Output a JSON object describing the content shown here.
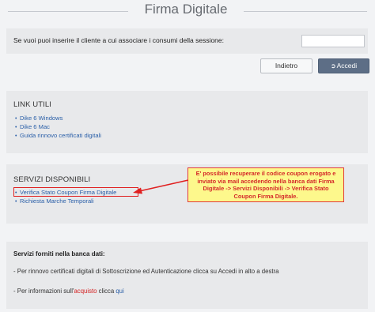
{
  "page": {
    "title": "Firma Digitale"
  },
  "client": {
    "prompt": "Se vuoi puoi inserire il cliente a cui associare i consumi della sessione:",
    "input_value": "",
    "input_placeholder": ""
  },
  "buttons": {
    "back_label": "Indietro",
    "login_label": "Accedi",
    "login_icon": "sign-in-icon"
  },
  "links_panel": {
    "heading": "LINK UTILI",
    "items": [
      {
        "label": "Dike 6 Windows"
      },
      {
        "label": "Dike 6 Mac"
      },
      {
        "label": "Guida rinnovo certificati digitali"
      }
    ]
  },
  "services_panel": {
    "heading": "SERVIZI DISPONIBILI",
    "items": [
      {
        "label": "Verifica Stato Coupon Firma Digitale"
      },
      {
        "label": "Richiesta Marche Temporali"
      }
    ]
  },
  "callout": {
    "text": "E' possibile recuperare il codice coupon erogato e inviato via mail accedendo nella banca dati Firma Digitale -> Servizi Disponibili -> Verifica Stato Coupon Firma Digitale."
  },
  "info_panel": {
    "heading": "Servizi forniti nella banca dati:",
    "line1": "- Per rinnovo certificati digitali di Sottoscrizione ed Autenticazione clicca su Accedi in alto a destra",
    "line2_prefix": "- Per informazioni sull'",
    "line2_link1": "acquisto",
    "line2_middle": " clicca ",
    "line2_link2": "qui"
  },
  "colors": {
    "background": "#f2f3f5",
    "panel": "#e8e9eb",
    "link": "#2a5fa8",
    "accent_button": "#5d6e86",
    "annotation_red": "#e02020",
    "callout_yellow": "#fdf88c"
  }
}
